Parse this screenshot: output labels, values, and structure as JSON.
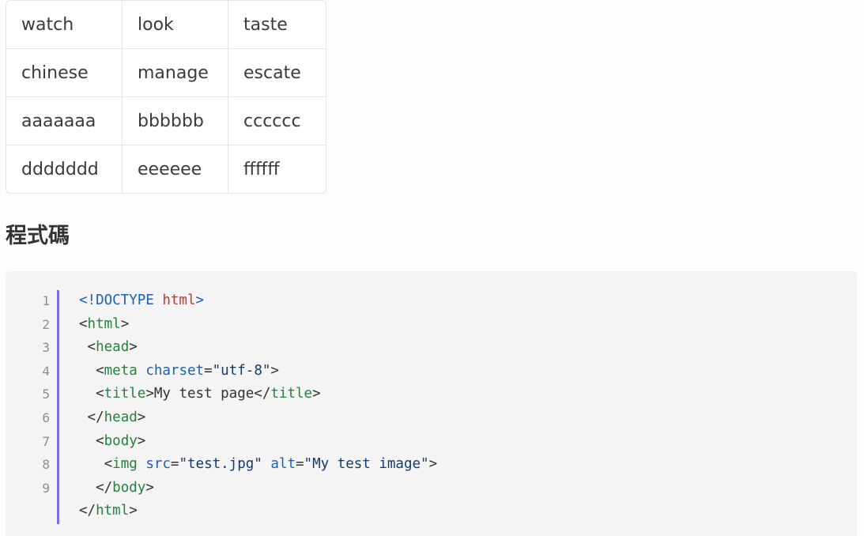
{
  "table": {
    "rows": [
      [
        "watch",
        "look",
        "taste"
      ],
      [
        "chinese",
        "manage",
        "escate"
      ],
      [
        "aaaaaaa",
        "bbbbbb",
        "cccccc"
      ],
      [
        "ddddddd",
        "eeeeee",
        "ffffff"
      ]
    ]
  },
  "section": {
    "heading": "程式碼"
  },
  "code": {
    "line_numbers": [
      "1",
      "2",
      "3",
      "4",
      "5",
      "6",
      "7",
      "8",
      "9"
    ],
    "lines": [
      {
        "indent": "",
        "tokens": [
          {
            "t": "<!DOCTYPE ",
            "k": "doctype"
          },
          {
            "t": "html",
            "k": "doctype-name"
          },
          {
            "t": ">",
            "k": "doctype"
          }
        ]
      },
      {
        "indent": "",
        "tokens": [
          {
            "t": "<",
            "k": "punct"
          },
          {
            "t": "html",
            "k": "tag"
          },
          {
            "t": ">",
            "k": "punct"
          }
        ]
      },
      {
        "indent": " ",
        "tokens": [
          {
            "t": "<",
            "k": "punct"
          },
          {
            "t": "head",
            "k": "tag"
          },
          {
            "t": ">",
            "k": "punct"
          }
        ]
      },
      {
        "indent": "  ",
        "tokens": [
          {
            "t": "<",
            "k": "punct"
          },
          {
            "t": "meta",
            "k": "tag"
          },
          {
            "t": " ",
            "k": "text"
          },
          {
            "t": "charset",
            "k": "attr"
          },
          {
            "t": "=",
            "k": "punct"
          },
          {
            "t": "\"utf-8\"",
            "k": "str"
          },
          {
            "t": ">",
            "k": "punct"
          }
        ]
      },
      {
        "indent": "  ",
        "tokens": [
          {
            "t": "<",
            "k": "punct"
          },
          {
            "t": "title",
            "k": "tag"
          },
          {
            "t": ">",
            "k": "punct"
          },
          {
            "t": "My test page",
            "k": "text"
          },
          {
            "t": "</",
            "k": "punct"
          },
          {
            "t": "title",
            "k": "tag"
          },
          {
            "t": ">",
            "k": "punct"
          }
        ]
      },
      {
        "indent": " ",
        "tokens": [
          {
            "t": "</",
            "k": "punct"
          },
          {
            "t": "head",
            "k": "tag"
          },
          {
            "t": ">",
            "k": "punct"
          }
        ]
      },
      {
        "indent": "  ",
        "tokens": [
          {
            "t": "<",
            "k": "punct"
          },
          {
            "t": "body",
            "k": "tag"
          },
          {
            "t": ">",
            "k": "punct"
          }
        ]
      },
      {
        "indent": "   ",
        "tokens": [
          {
            "t": "<",
            "k": "punct"
          },
          {
            "t": "img",
            "k": "tag"
          },
          {
            "t": " ",
            "k": "text"
          },
          {
            "t": "src",
            "k": "attr"
          },
          {
            "t": "=",
            "k": "punct"
          },
          {
            "t": "\"test.jpg\"",
            "k": "str"
          },
          {
            "t": " ",
            "k": "text"
          },
          {
            "t": "alt",
            "k": "attr"
          },
          {
            "t": "=",
            "k": "punct"
          },
          {
            "t": "\"My test image\"",
            "k": "str"
          },
          {
            "t": ">",
            "k": "punct"
          }
        ]
      },
      {
        "indent": "  ",
        "tokens": [
          {
            "t": "</",
            "k": "punct"
          },
          {
            "t": "body",
            "k": "tag"
          },
          {
            "t": ">",
            "k": "punct"
          }
        ]
      },
      {
        "indent": "",
        "tokens": [
          {
            "t": "</",
            "k": "punct"
          },
          {
            "t": "html",
            "k": "tag"
          },
          {
            "t": ">",
            "k": "punct"
          }
        ]
      }
    ]
  },
  "colors": {
    "gutter_accent": "#7b6fe0",
    "code_background": "#f4f4f4",
    "tag": "#26823a",
    "attr": "#1b5fb8",
    "doctype_name": "#c0392b"
  }
}
